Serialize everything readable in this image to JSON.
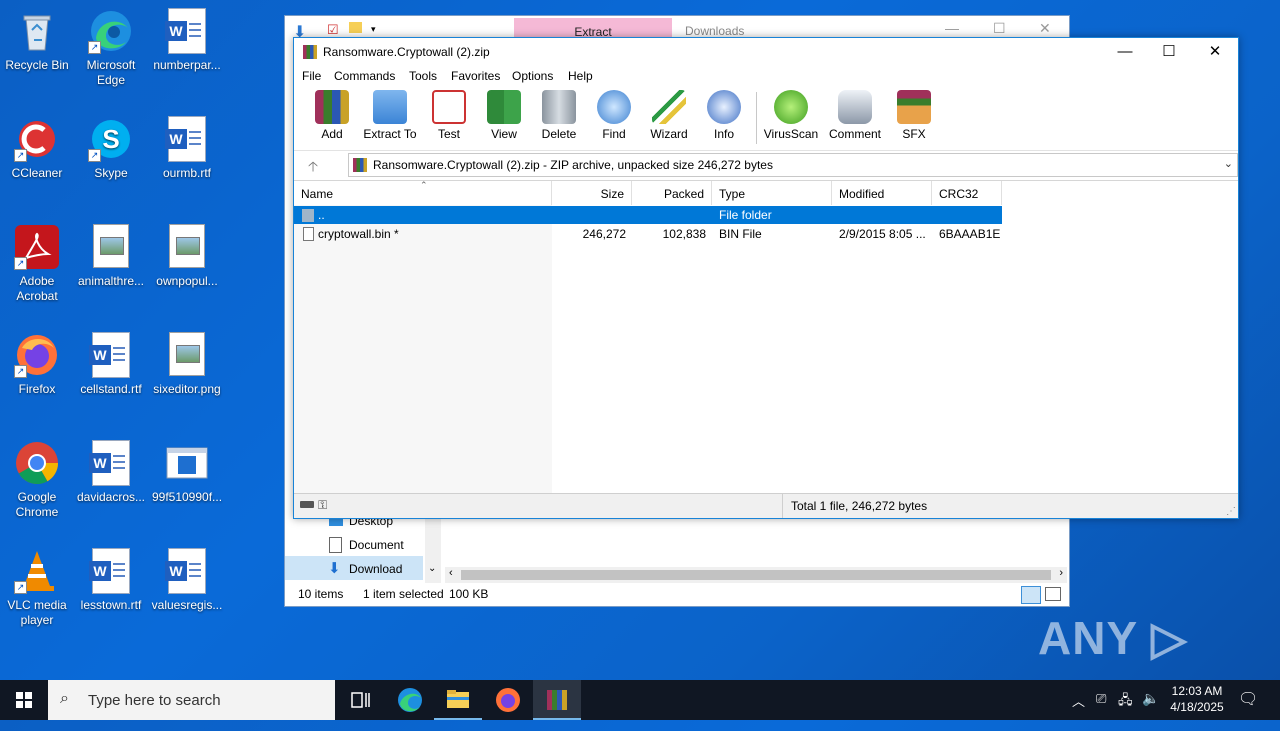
{
  "desktop": {
    "icons": [
      {
        "label": "Recycle Bin"
      },
      {
        "label": "Microsoft Edge"
      },
      {
        "label": "numberpar..."
      },
      {
        "label": "CCleaner"
      },
      {
        "label": "Skype"
      },
      {
        "label": "ourmb.rtf"
      },
      {
        "label": "Adobe Acrobat"
      },
      {
        "label": "animalthre..."
      },
      {
        "label": "ownpopul..."
      },
      {
        "label": "Firefox"
      },
      {
        "label": "cellstand.rtf"
      },
      {
        "label": "sixeditor.png"
      },
      {
        "label": "Google Chrome"
      },
      {
        "label": "davidacros..."
      },
      {
        "label": "99f510990f..."
      },
      {
        "label": "VLC media player"
      },
      {
        "label": "lesstown.rtf"
      },
      {
        "label": "valuesregis..."
      }
    ]
  },
  "explorer": {
    "tab_extract": "Extract",
    "title": "Downloads",
    "nav": [
      "Desktop",
      "Document",
      "Download"
    ],
    "status": {
      "items": "10 items",
      "selected": "1 item selected",
      "size": "100 KB"
    }
  },
  "winrar": {
    "title": "Ransomware.Cryptowall (2).zip",
    "menu": [
      "File",
      "Commands",
      "Tools",
      "Favorites",
      "Options",
      "Help"
    ],
    "toolbar": [
      "Add",
      "Extract To",
      "Test",
      "View",
      "Delete",
      "Find",
      "Wizard",
      "Info",
      "VirusScan",
      "Comment",
      "SFX"
    ],
    "address": "Ransomware.Cryptowall (2).zip - ZIP archive, unpacked size 246,272 bytes",
    "columns": [
      "Name",
      "Size",
      "Packed",
      "Type",
      "Modified",
      "CRC32"
    ],
    "rows": [
      {
        "name": "..",
        "size": "",
        "packed": "",
        "type": "File folder",
        "modified": "",
        "crc": ""
      },
      {
        "name": "cryptowall.bin *",
        "size": "246,272",
        "packed": "102,838",
        "type": "BIN File",
        "modified": "2/9/2015 8:05 ...",
        "crc": "6BAAAB1E"
      }
    ],
    "status_total": "Total 1 file, 246,272 bytes"
  },
  "watermark": "ANY ▷ RUN",
  "taskbar": {
    "search_placeholder": "Type here to search",
    "time": "12:03 AM",
    "date": "4/18/2025"
  },
  "colors": {
    "selection": "#0078d7",
    "desktop": "#0a6ad8",
    "taskbar": "#101723"
  }
}
